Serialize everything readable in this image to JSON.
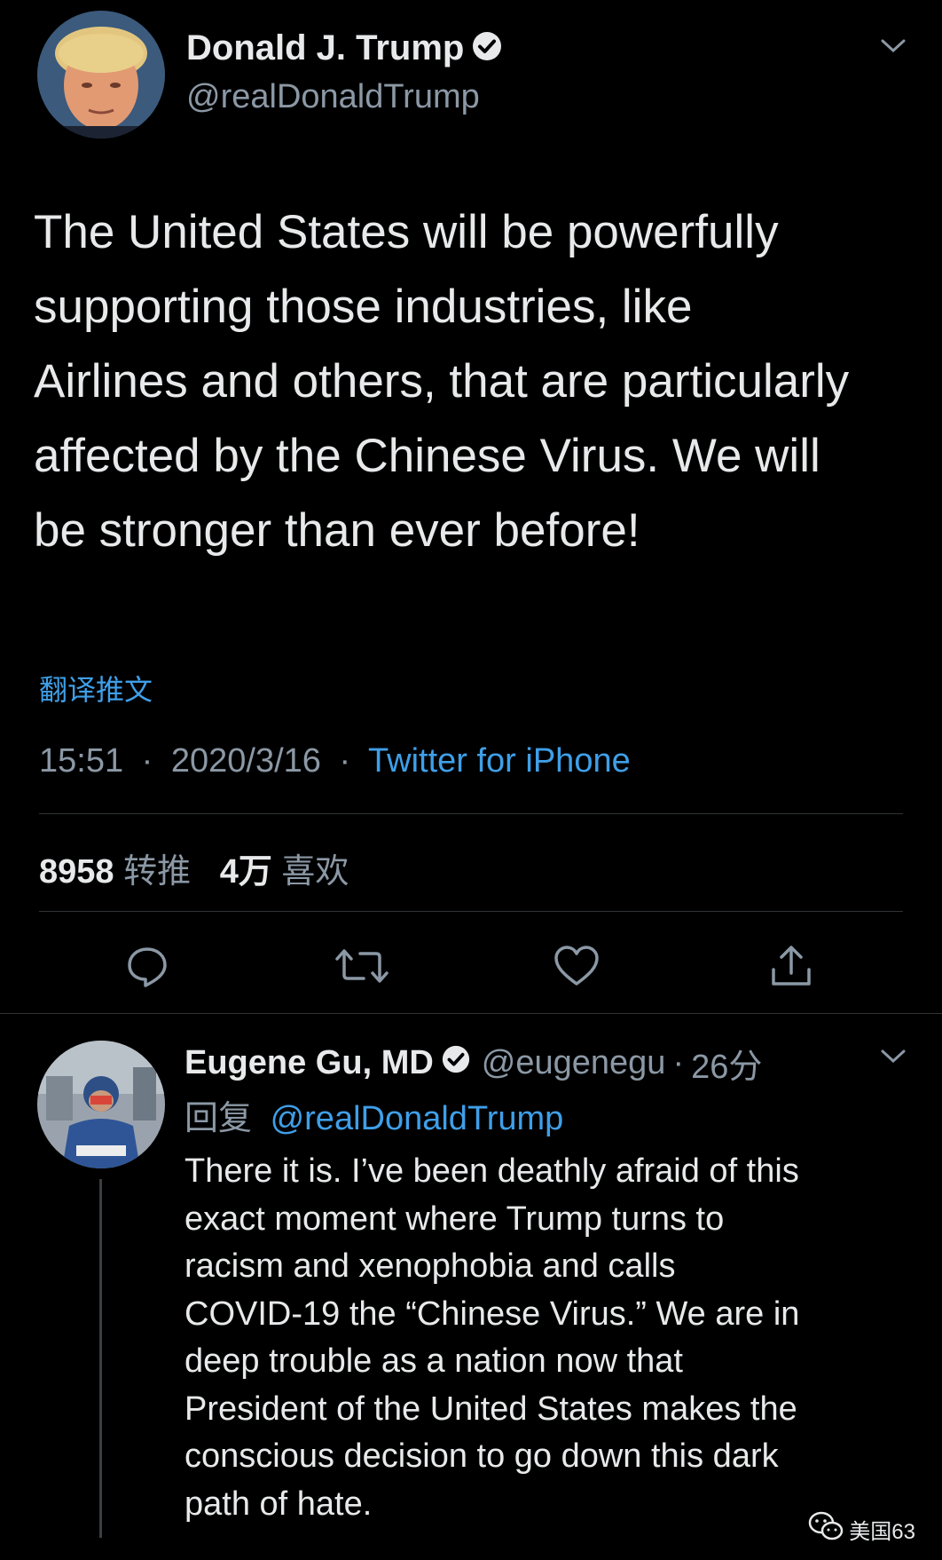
{
  "main_tweet": {
    "author_name": "Donald J. Trump",
    "author_handle": "@realDonaldTrump",
    "text_lines": [
      "The United States will be powerfully",
      "supporting those industries, like",
      "Airlines and others, that are particularly",
      "affected by the Chinese Virus. We will",
      "be stronger than ever before!"
    ],
    "translate_label": "翻译推文",
    "time": "15:51",
    "date": "2020/3/16",
    "separator": "·",
    "source": "Twitter for iPhone",
    "retweet_count": "8958",
    "retweet_label": "转推",
    "like_count": "4万",
    "like_label": "喜欢"
  },
  "reply_tweet": {
    "author_name": "Eugene Gu, MD",
    "author_handle": "@eugenegu",
    "separator": "·",
    "time_ago": "26分",
    "reply_label": "回复",
    "reply_mention": "@realDonaldTrump",
    "text_lines": [
      "There it is. I’ve been deathly afraid of this",
      "exact moment where Trump turns to",
      "racism and xenophobia and calls",
      "COVID-19 the “Chinese Virus.” We are in",
      "deep trouble as a nation now that",
      "President of the United States makes the",
      "conscious decision to go down this dark",
      "path of hate."
    ]
  },
  "watermark": {
    "label": "美国63"
  },
  "icons": {
    "verified": "verified-badge-icon",
    "chevron": "chevron-down-icon",
    "reply": "reply-icon",
    "retweet": "retweet-icon",
    "like": "heart-icon",
    "share": "share-icon",
    "wechat": "wechat-icon"
  },
  "colors": {
    "background": "#000000",
    "text": "#e7e9ea",
    "secondary": "#8b98a5",
    "link": "#3f9fe8",
    "divider": "#2f3336"
  }
}
